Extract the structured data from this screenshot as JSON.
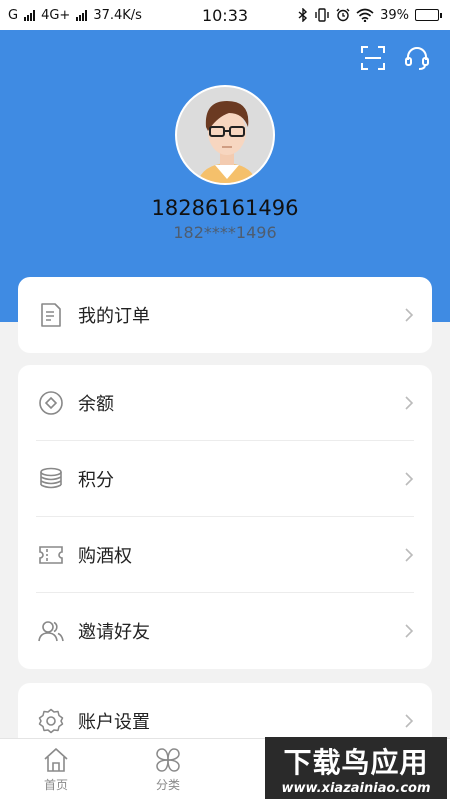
{
  "status_bar": {
    "carrier": "G",
    "network": "4G+",
    "speed": "37.4K/s",
    "time": "10:33",
    "battery": "39%",
    "battery_level": 0.39
  },
  "profile": {
    "phone": "18286161496",
    "masked_phone": "182****1496"
  },
  "header_icons": [
    "scan-icon",
    "headset-icon"
  ],
  "orders_card": {
    "label": "我的订单",
    "icon": "document-icon"
  },
  "menu": {
    "items": [
      {
        "label": "余额",
        "icon": "balance-icon"
      },
      {
        "label": "积分",
        "icon": "coins-icon"
      },
      {
        "label": "购酒权",
        "icon": "ticket-icon"
      },
      {
        "label": "邀请好友",
        "icon": "invite-friends-icon"
      }
    ]
  },
  "settings_card": {
    "label": "账户设置",
    "icon": "gear-icon"
  },
  "tabbar": {
    "tabs": [
      {
        "label": "首页",
        "icon": "home-icon"
      },
      {
        "label": "分类",
        "icon": "category-icon"
      }
    ]
  },
  "watermark": {
    "title": "下载鸟应用",
    "url": "www.xiazainiao.com"
  },
  "colors": {
    "header_blue": "#3f8be3",
    "background": "#f2f2f2",
    "battery_green": "#29c12e"
  }
}
